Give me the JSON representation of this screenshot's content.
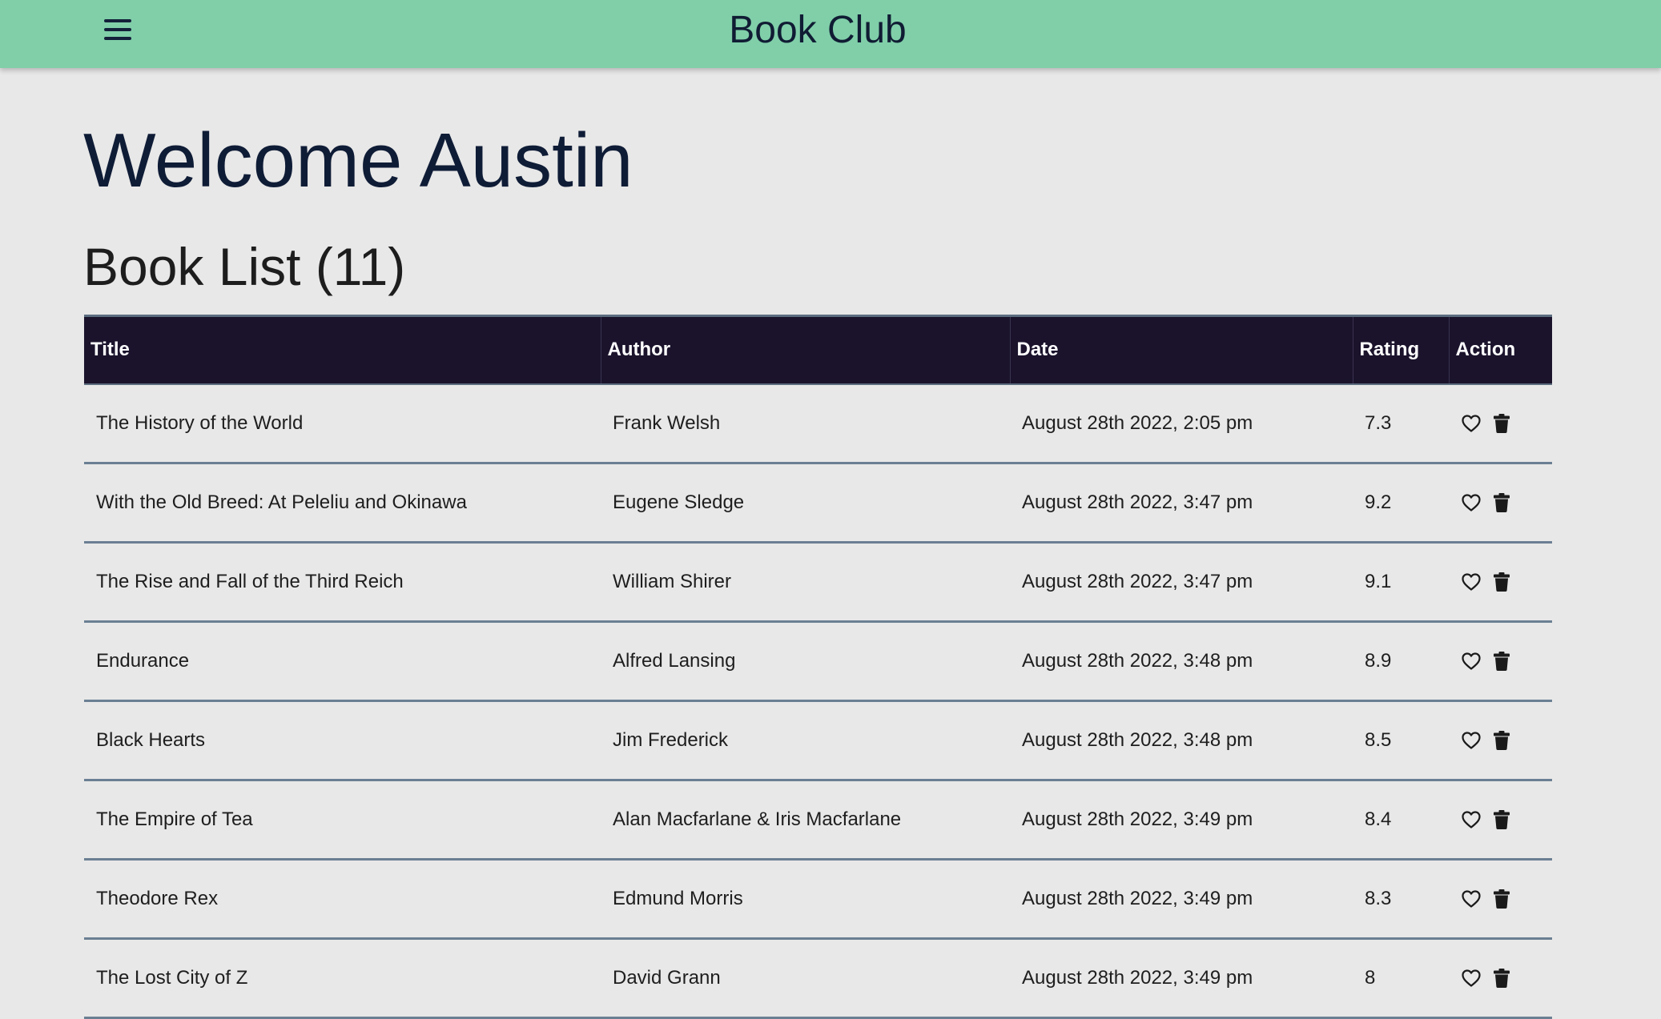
{
  "navbar": {
    "menu_icon": "hamburger-menu-icon",
    "title": "Book Club",
    "background": "#80cfa9"
  },
  "welcome": "Welcome Austin",
  "book_list": {
    "heading": "Book List (11)",
    "columns": [
      "Title",
      "Author",
      "Date",
      "Rating",
      "Action"
    ],
    "action_icons": [
      "heart-icon",
      "trash-icon"
    ],
    "rows": [
      {
        "title": "The History of the World",
        "author": "Frank Welsh",
        "date": "August 28th 2022, 2:05 pm",
        "rating": "7.3"
      },
      {
        "title": "With the Old Breed: At Peleliu and Okinawa",
        "author": "Eugene Sledge",
        "date": "August 28th 2022, 3:47 pm",
        "rating": "9.2"
      },
      {
        "title": "The Rise and Fall of the Third Reich",
        "author": "William Shirer",
        "date": "August 28th 2022, 3:47 pm",
        "rating": "9.1"
      },
      {
        "title": "Endurance",
        "author": "Alfred Lansing",
        "date": "August 28th 2022, 3:48 pm",
        "rating": "8.9"
      },
      {
        "title": "Black Hearts",
        "author": "Jim Frederick",
        "date": "August 28th 2022, 3:48 pm",
        "rating": "8.5"
      },
      {
        "title": "The Empire of Tea",
        "author": "Alan Macfarlane & Iris Macfarlane",
        "date": "August 28th 2022, 3:49 pm",
        "rating": "8.4"
      },
      {
        "title": "Theodore Rex",
        "author": "Edmund Morris",
        "date": "August 28th 2022, 3:49 pm",
        "rating": "8.3"
      },
      {
        "title": "The Lost City of Z",
        "author": "David Grann",
        "date": "August 28th 2022, 3:49 pm",
        "rating": "8"
      }
    ]
  },
  "colors": {
    "header_row": "#1b132c",
    "page_background": "#e8e8e8",
    "row_divider": "#6b7f93"
  }
}
